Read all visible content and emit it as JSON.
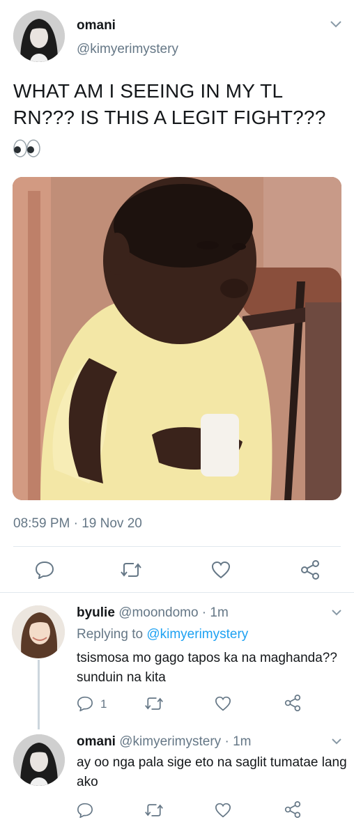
{
  "main_tweet": {
    "name": "omani",
    "handle": "@kimyerimystery",
    "text": "WHAT AM I SEEING IN MY TL RN??? IS THIS A LEGIT FIGHT???",
    "emoji": "eyes",
    "media": "meme photo of a child in a yellow shirt glancing sideways",
    "timestamp": "08:59 PM · 19 Nov 20",
    "actions": [
      "reply-icon",
      "retweet-icon",
      "like-icon",
      "share-icon"
    ]
  },
  "reply1": {
    "name": "byulie",
    "handle": "@moondomo · 1m",
    "replying_label": "Replying to",
    "replying_to": "@kimyerimystery",
    "text": "tsismosa mo gago tapos ka na maghanda?? sunduin na kita",
    "reply_count": "1"
  },
  "reply2": {
    "name": "omani",
    "handle": "@kimyerimystery · 1m",
    "text": "ay oo nga pala sige eto na saglit tumatae lang ako"
  },
  "colors": {
    "text": "#14171a",
    "secondary": "#657786",
    "link": "#1da1f2",
    "divider": "#e1e8ed"
  }
}
